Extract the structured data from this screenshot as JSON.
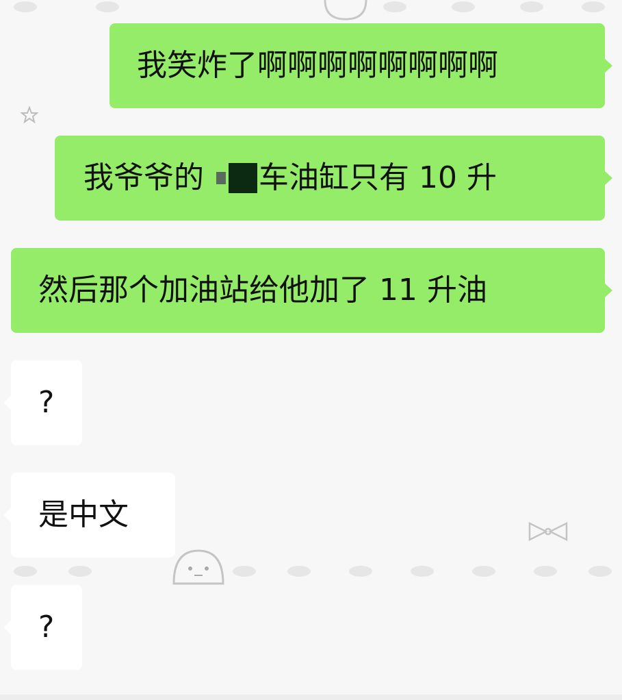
{
  "chat": {
    "messages": [
      {
        "side": "sent",
        "text": "我笑炸了啊啊啊啊啊啊啊啊"
      },
      {
        "side": "sent",
        "text_before": "我爷爷的",
        "text_after": "车油缸只有 10 升"
      },
      {
        "side": "sent",
        "text": "然后那个加油站给他加了 11 升油"
      },
      {
        "side": "recv",
        "text": "?"
      },
      {
        "side": "recv",
        "text": "是中文"
      },
      {
        "side": "recv",
        "text": "?"
      }
    ]
  },
  "colors": {
    "sent_bubble": "#95ec69",
    "recv_bubble": "#ffffff",
    "background": "#f7f7f7",
    "text": "#111111"
  },
  "icons": [
    "star-doodle-icon",
    "bow-doodle-icon",
    "bun-face-doodle-icon",
    "paw-print-icon"
  ]
}
